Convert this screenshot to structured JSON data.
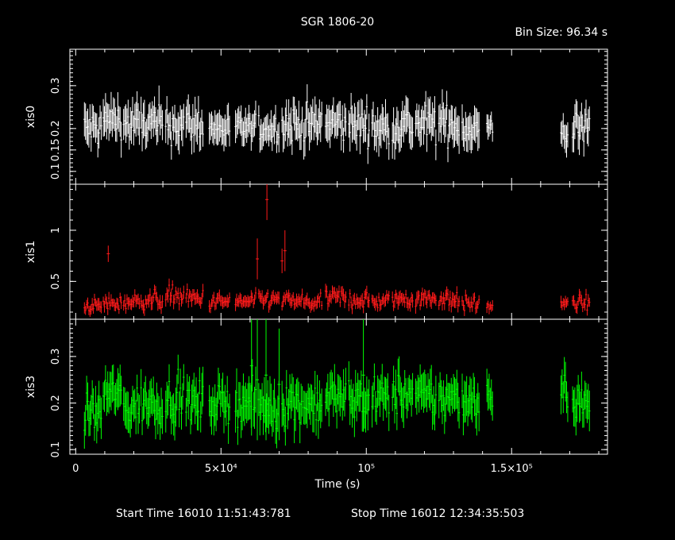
{
  "title": "SGR 1806-20",
  "bin_size_label": "Bin Size: 96.34 s",
  "footer": {
    "start": "Start Time 16010 11:51:43:781",
    "stop": "Stop Time 16012 12:34:35:503"
  },
  "chart_data": {
    "type": "scatter",
    "style": "light curve with vertical error bars, three stacked panels sharing the time axis",
    "x_axis": {
      "label": "Time (s)",
      "range": [
        -2000,
        183000
      ],
      "ticks": [
        0,
        50000,
        100000,
        150000
      ],
      "tick_labels": [
        "0",
        "5×10⁴",
        "10⁵",
        "1.5×10⁵"
      ]
    },
    "gaps": [
      [
        143500,
        167000
      ]
    ],
    "panels": [
      {
        "name": "xis0",
        "ylabel": "xis0",
        "color": "#ffffff",
        "y_range": [
          0.07,
          0.385
        ],
        "y_ticks": [
          0.1,
          0.15,
          0.2,
          0.3
        ],
        "y_tick_labels": [
          "0.1",
          "0.15",
          "0.2",
          "0.3"
        ],
        "segments": [
          {
            "t": [
              3000,
              9000
            ],
            "mean": 0.2,
            "std": 0.03,
            "err": 0.035
          },
          {
            "t": [
              9500,
              16000
            ],
            "mean": 0.22,
            "std": 0.025,
            "err": 0.035
          },
          {
            "t": [
              16500,
              22000
            ],
            "mean": 0.21,
            "std": 0.03,
            "err": 0.035
          },
          {
            "t": [
              22500,
              30000
            ],
            "mean": 0.21,
            "std": 0.028,
            "err": 0.035
          },
          {
            "t": [
              31000,
              37500
            ],
            "mean": 0.21,
            "std": 0.03,
            "err": 0.035
          },
          {
            "t": [
              38000,
              44000
            ],
            "mean": 0.21,
            "std": 0.028,
            "err": 0.035
          },
          {
            "t": [
              46000,
              53000
            ],
            "mean": 0.2,
            "std": 0.02,
            "err": 0.03
          },
          {
            "t": [
              55000,
              62000
            ],
            "mean": 0.2,
            "std": 0.02,
            "err": 0.03
          },
          {
            "t": [
              63000,
              70000
            ],
            "mean": 0.2,
            "std": 0.02,
            "err": 0.03
          },
          {
            "t": [
              71000,
              78000
            ],
            "mean": 0.21,
            "std": 0.028,
            "err": 0.035
          },
          {
            "t": [
              78500,
              85000
            ],
            "mean": 0.21,
            "std": 0.03,
            "err": 0.035
          },
          {
            "t": [
              86000,
              93000
            ],
            "mean": 0.21,
            "std": 0.03,
            "err": 0.035
          },
          {
            "t": [
              94000,
              101000
            ],
            "mean": 0.21,
            "std": 0.028,
            "err": 0.035
          },
          {
            "t": [
              102000,
              108000
            ],
            "mean": 0.2,
            "std": 0.03,
            "err": 0.035
          },
          {
            "t": [
              109000,
              116000
            ],
            "mean": 0.21,
            "std": 0.03,
            "err": 0.035
          },
          {
            "t": [
              117000,
              124000
            ],
            "mean": 0.21,
            "std": 0.03,
            "err": 0.035
          },
          {
            "t": [
              125000,
              132000
            ],
            "mean": 0.21,
            "std": 0.03,
            "err": 0.035
          },
          {
            "t": [
              133000,
              139000
            ],
            "mean": 0.2,
            "std": 0.025,
            "err": 0.035
          },
          {
            "t": [
              141500,
              143500
            ],
            "mean": 0.2,
            "std": 0.015,
            "err": 0.025
          },
          {
            "t": [
              167000,
              169500
            ],
            "mean": 0.19,
            "std": 0.02,
            "err": 0.03
          },
          {
            "t": [
              171000,
              177000
            ],
            "mean": 0.2,
            "std": 0.03,
            "err": 0.035
          }
        ]
      },
      {
        "name": "xis1",
        "ylabel": "xis1",
        "color": "#ff1a1a",
        "y_range": [
          0.13,
          1.45
        ],
        "y_ticks": [
          0.5,
          1.0
        ],
        "y_tick_labels": [
          "0.5",
          "1"
        ],
        "segments": [
          {
            "t": [
              3000,
              9000
            ],
            "mean": 0.26,
            "std": 0.04,
            "err": 0.05
          },
          {
            "t": [
              9500,
              16000
            ],
            "mean": 0.28,
            "std": 0.05,
            "err": 0.05
          },
          {
            "t": [
              16500,
              22000
            ],
            "mean": 0.3,
            "std": 0.05,
            "err": 0.05
          },
          {
            "t": [
              22500,
              30000
            ],
            "mean": 0.32,
            "std": 0.06,
            "err": 0.055
          },
          {
            "t": [
              31000,
              37500
            ],
            "mean": 0.36,
            "std": 0.07,
            "err": 0.055
          },
          {
            "t": [
              38000,
              44000
            ],
            "mean": 0.33,
            "std": 0.06,
            "err": 0.055
          },
          {
            "t": [
              46000,
              53000
            ],
            "mean": 0.3,
            "std": 0.05,
            "err": 0.05
          },
          {
            "t": [
              55000,
              62000
            ],
            "mean": 0.3,
            "std": 0.05,
            "err": 0.05
          },
          {
            "t": [
              63000,
              70000
            ],
            "mean": 0.32,
            "std": 0.05,
            "err": 0.05
          },
          {
            "t": [
              71000,
              78000
            ],
            "mean": 0.31,
            "std": 0.05,
            "err": 0.05
          },
          {
            "t": [
              78500,
              85000
            ],
            "mean": 0.29,
            "std": 0.05,
            "err": 0.05
          },
          {
            "t": [
              86000,
              93000
            ],
            "mean": 0.34,
            "std": 0.06,
            "err": 0.055
          },
          {
            "t": [
              94000,
              101000
            ],
            "mean": 0.32,
            "std": 0.06,
            "err": 0.055
          },
          {
            "t": [
              102000,
              108000
            ],
            "mean": 0.3,
            "std": 0.05,
            "err": 0.05
          },
          {
            "t": [
              109000,
              116000
            ],
            "mean": 0.33,
            "std": 0.06,
            "err": 0.055
          },
          {
            "t": [
              117000,
              124000
            ],
            "mean": 0.33,
            "std": 0.06,
            "err": 0.055
          },
          {
            "t": [
              125000,
              132000
            ],
            "mean": 0.33,
            "std": 0.06,
            "err": 0.055
          },
          {
            "t": [
              133000,
              139000
            ],
            "mean": 0.28,
            "std": 0.05,
            "err": 0.05
          },
          {
            "t": [
              141500,
              143500
            ],
            "mean": 0.26,
            "std": 0.03,
            "err": 0.04
          },
          {
            "t": [
              167000,
              169500
            ],
            "mean": 0.27,
            "std": 0.04,
            "err": 0.05
          },
          {
            "t": [
              171000,
              177000
            ],
            "mean": 0.29,
            "std": 0.05,
            "err": 0.05
          }
        ],
        "outliers": [
          {
            "x": 11200,
            "y": 0.77,
            "err": 0.08
          },
          {
            "x": 62500,
            "y": 0.72,
            "err": 0.2
          },
          {
            "x": 65800,
            "y": 1.3,
            "err": 0.2
          },
          {
            "x": 72000,
            "y": 0.8,
            "err": 0.2
          },
          {
            "x": 71000,
            "y": 0.7,
            "err": 0.12
          }
        ]
      },
      {
        "name": "xis3",
        "ylabel": "xis3",
        "color": "#00ff00",
        "y_range": [
          0.09,
          0.38
        ],
        "y_ticks": [
          0.1,
          0.2,
          0.3
        ],
        "y_tick_labels": [
          "0.1",
          "0.2",
          "0.3"
        ],
        "segments": [
          {
            "t": [
              3000,
              9000
            ],
            "mean": 0.18,
            "std": 0.03,
            "err": 0.035
          },
          {
            "t": [
              9500,
              16000
            ],
            "mean": 0.22,
            "std": 0.025,
            "err": 0.035
          },
          {
            "t": [
              16500,
              22000
            ],
            "mean": 0.19,
            "std": 0.03,
            "err": 0.035
          },
          {
            "t": [
              22500,
              30000
            ],
            "mean": 0.2,
            "std": 0.03,
            "err": 0.035
          },
          {
            "t": [
              31000,
              37500
            ],
            "mean": 0.21,
            "std": 0.03,
            "err": 0.035
          },
          {
            "t": [
              38000,
              44000
            ],
            "mean": 0.2,
            "std": 0.03,
            "err": 0.035
          },
          {
            "t": [
              46000,
              53000
            ],
            "mean": 0.2,
            "std": 0.025,
            "err": 0.035
          },
          {
            "t": [
              55000,
              62000
            ],
            "mean": 0.2,
            "std": 0.03,
            "err": 0.04
          },
          {
            "t": [
              63000,
              70000
            ],
            "mean": 0.19,
            "std": 0.03,
            "err": 0.04
          },
          {
            "t": [
              71000,
              78000
            ],
            "mean": 0.2,
            "std": 0.03,
            "err": 0.04
          },
          {
            "t": [
              78500,
              85000
            ],
            "mean": 0.2,
            "std": 0.03,
            "err": 0.035
          },
          {
            "t": [
              86000,
              93000
            ],
            "mean": 0.21,
            "std": 0.03,
            "err": 0.035
          },
          {
            "t": [
              94000,
              101000
            ],
            "mean": 0.21,
            "std": 0.03,
            "err": 0.035
          },
          {
            "t": [
              102000,
              108000
            ],
            "mean": 0.21,
            "std": 0.03,
            "err": 0.035
          },
          {
            "t": [
              109000,
              116000
            ],
            "mean": 0.22,
            "std": 0.03,
            "err": 0.035
          },
          {
            "t": [
              117000,
              124000
            ],
            "mean": 0.21,
            "std": 0.03,
            "err": 0.035
          },
          {
            "t": [
              125000,
              132000
            ],
            "mean": 0.21,
            "std": 0.03,
            "err": 0.035
          },
          {
            "t": [
              133000,
              139000
            ],
            "mean": 0.21,
            "std": 0.03,
            "err": 0.035
          },
          {
            "t": [
              141500,
              143500
            ],
            "mean": 0.22,
            "std": 0.02,
            "err": 0.03
          },
          {
            "t": [
              167000,
              169500
            ],
            "mean": 0.22,
            "std": 0.03,
            "err": 0.035
          },
          {
            "t": [
              171000,
              177000
            ],
            "mean": 0.2,
            "std": 0.03,
            "err": 0.035
          }
        ],
        "outliers": [
          {
            "x": 60500,
            "y": 0.28,
            "err": 0.15
          },
          {
            "x": 62500,
            "y": 0.25,
            "err": 0.13
          },
          {
            "x": 65500,
            "y": 0.26,
            "err": 0.14
          },
          {
            "x": 70000,
            "y": 0.24,
            "err": 0.12
          },
          {
            "x": 99000,
            "y": 0.26,
            "err": 0.12
          }
        ]
      }
    ]
  }
}
